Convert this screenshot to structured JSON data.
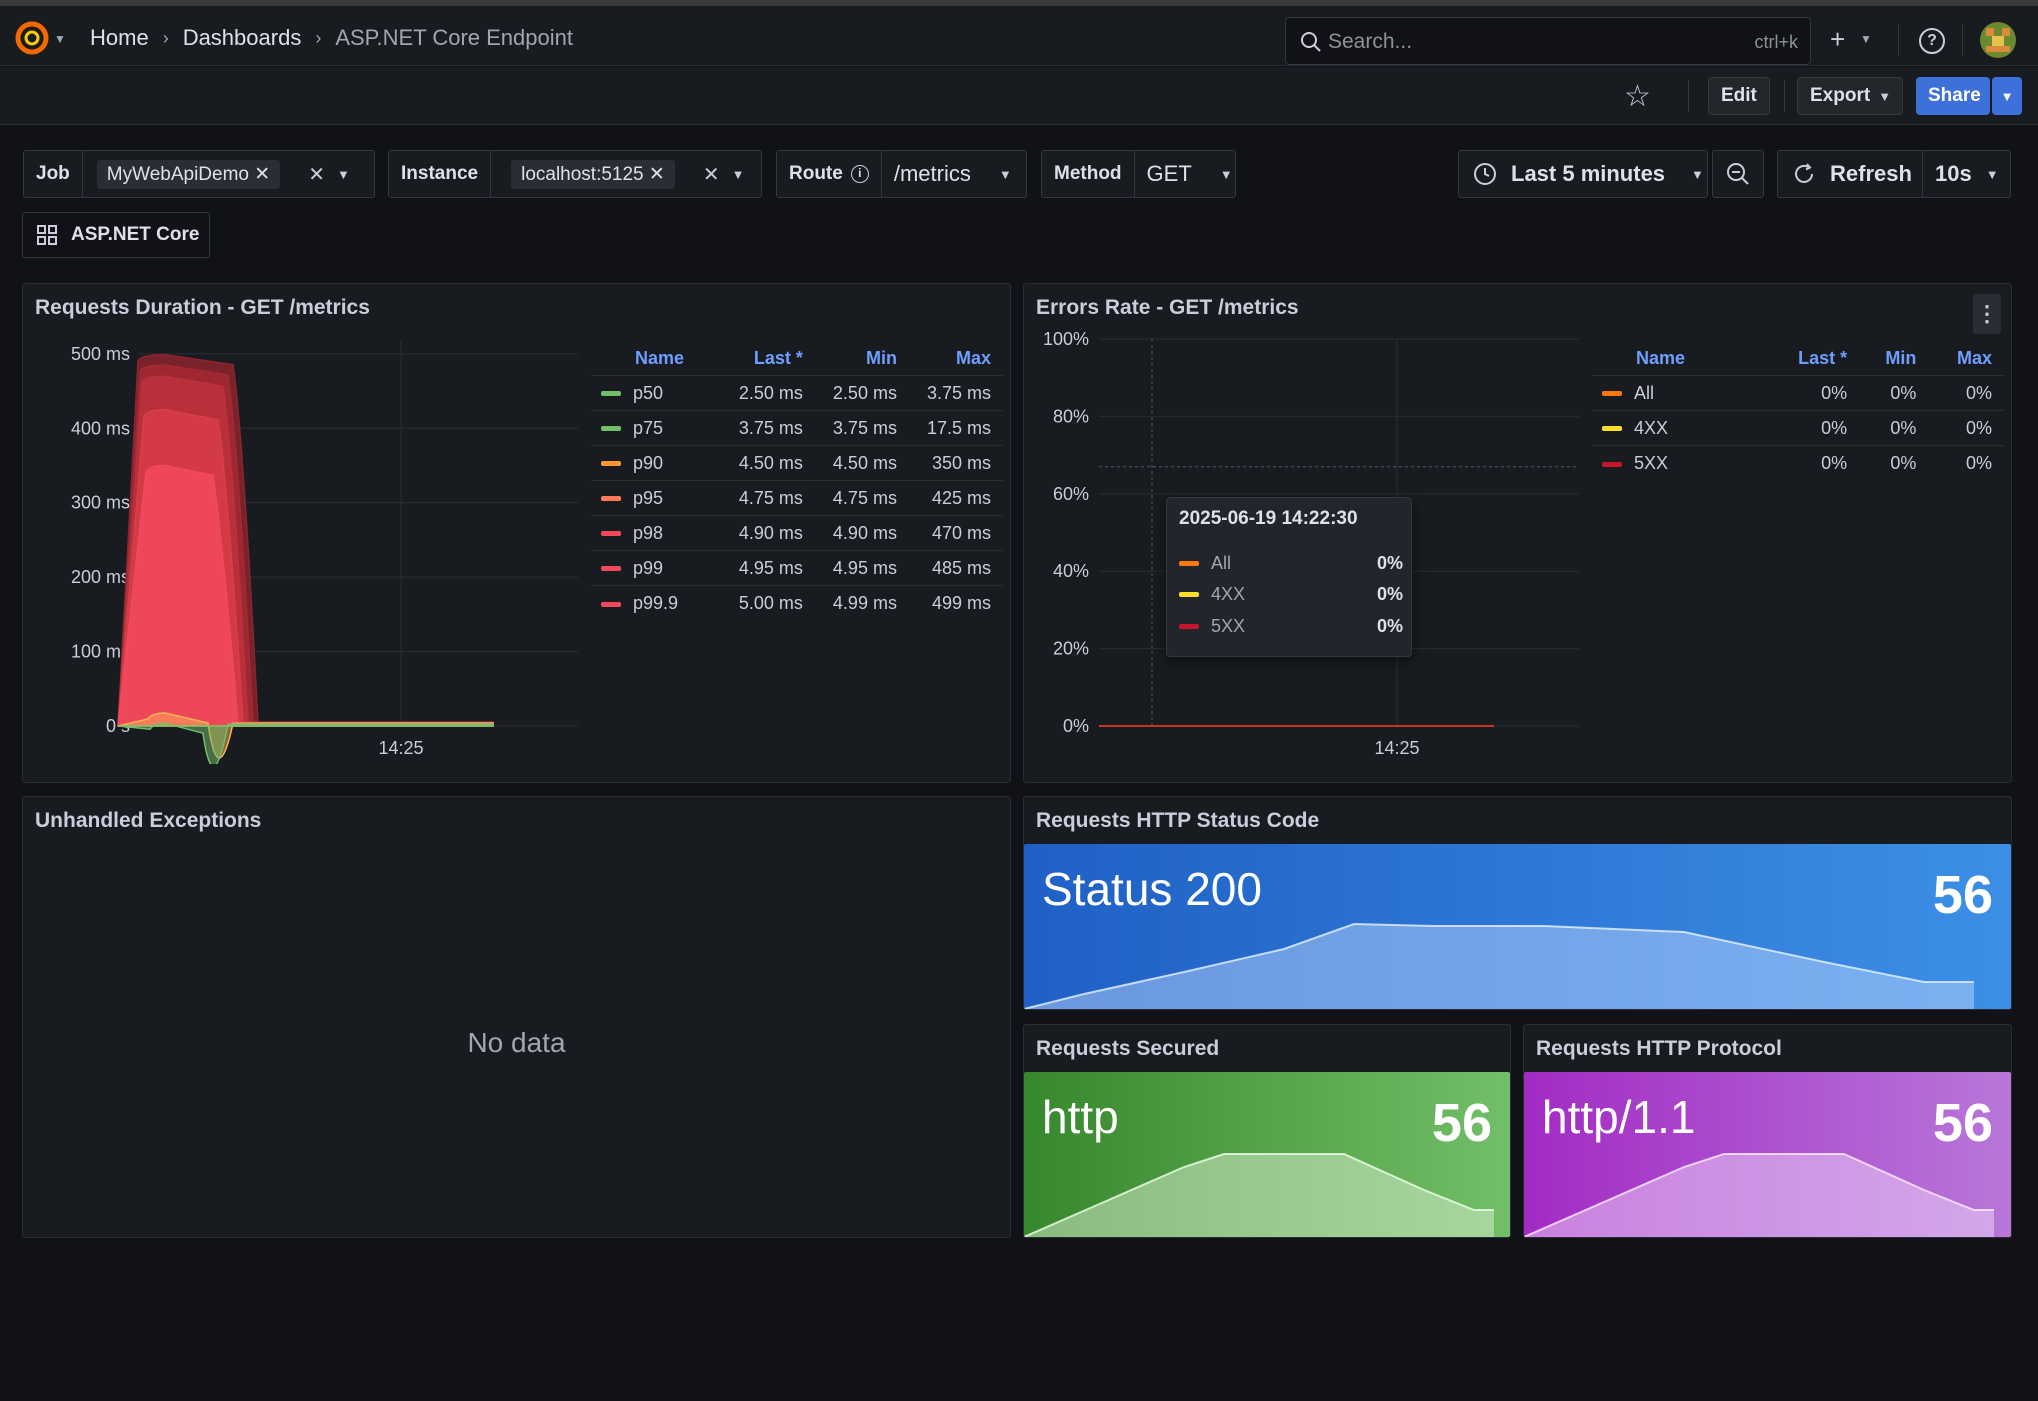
{
  "breadcrumb": {
    "home": "Home",
    "dashboards": "Dashboards",
    "current": "ASP.NET Core Endpoint"
  },
  "search": {
    "placeholder": "Search...",
    "shortcut": "ctrl+k"
  },
  "toolbar": {
    "edit": "Edit",
    "export": "Export",
    "share": "Share"
  },
  "variables": {
    "job": {
      "label": "Job",
      "value": "MyWebApiDemo"
    },
    "instance": {
      "label": "Instance",
      "value": "localhost:5125"
    },
    "route": {
      "label": "Route",
      "value": "/metrics"
    },
    "method": {
      "label": "Method",
      "value": "GET"
    }
  },
  "time": {
    "range": "Last 5 minutes",
    "refresh": "Refresh",
    "interval": "10s"
  },
  "link_button": "ASP.NET Core",
  "panels": {
    "duration": {
      "title": "Requests Duration - GET /metrics",
      "legend_headers": [
        "Name",
        "Last *",
        "Min",
        "Max"
      ],
      "legend": [
        {
          "name": "p50",
          "last": "2.50 ms",
          "min": "2.50 ms",
          "max": "3.75 ms",
          "color": "#73bf69"
        },
        {
          "name": "p75",
          "last": "3.75 ms",
          "min": "3.75 ms",
          "max": "17.5 ms",
          "color": "#73bf69"
        },
        {
          "name": "p90",
          "last": "4.50 ms",
          "min": "4.50 ms",
          "max": "350 ms",
          "color": "#ff9830"
        },
        {
          "name": "p95",
          "last": "4.75 ms",
          "min": "4.75 ms",
          "max": "425 ms",
          "color": "#ff7b57"
        },
        {
          "name": "p98",
          "last": "4.90 ms",
          "min": "4.90 ms",
          "max": "470 ms",
          "color": "#f2495c"
        },
        {
          "name": "p99",
          "last": "4.95 ms",
          "min": "4.95 ms",
          "max": "485 ms",
          "color": "#f2495c"
        },
        {
          "name": "p99.9",
          "last": "5.00 ms",
          "min": "4.99 ms",
          "max": "499 ms",
          "color": "#f2495c"
        }
      ]
    },
    "errors": {
      "title": "Errors Rate - GET /metrics",
      "legend_headers": [
        "Name",
        "Last *",
        "Min",
        "Max"
      ],
      "legend": [
        {
          "name": "All",
          "last": "0%",
          "min": "0%",
          "max": "0%",
          "color": "#ff780a"
        },
        {
          "name": "4XX",
          "last": "0%",
          "min": "0%",
          "max": "0%",
          "color": "#fade2a"
        },
        {
          "name": "5XX",
          "last": "0%",
          "min": "0%",
          "max": "0%",
          "color": "#c4162a"
        }
      ],
      "tooltip": {
        "time": "2025-06-19 14:22:30",
        "rows": [
          {
            "name": "All",
            "value": "0%",
            "color": "#ff780a"
          },
          {
            "name": "4XX",
            "value": "0%",
            "color": "#fade2a"
          },
          {
            "name": "5XX",
            "value": "0%",
            "color": "#c4162a"
          }
        ]
      }
    },
    "exceptions": {
      "title": "Unhandled Exceptions",
      "empty": "No data"
    },
    "status_code": {
      "title": "Requests HTTP Status Code",
      "label": "Status 200",
      "value": "56"
    },
    "secured": {
      "title": "Requests Secured",
      "label": "http",
      "value": "56"
    },
    "protocol": {
      "title": "Requests HTTP Protocol",
      "label": "http/1.1",
      "value": "56"
    }
  },
  "chart_data": [
    {
      "type": "area",
      "title": "Requests Duration - GET /metrics",
      "y_ticks": [
        "0 s",
        "100 ms",
        "200 ms",
        "300 ms",
        "400 ms",
        "500 ms"
      ],
      "x_ticks": [
        "14:25"
      ],
      "ylim": [
        0,
        520
      ],
      "series": [
        {
          "name": "p99.9",
          "peak": 499,
          "last": 5.0
        },
        {
          "name": "p99",
          "peak": 485,
          "last": 4.95
        },
        {
          "name": "p98",
          "peak": 470,
          "last": 4.9
        },
        {
          "name": "p95",
          "peak": 425,
          "last": 4.75
        },
        {
          "name": "p90",
          "peak": 350,
          "last": 4.5
        },
        {
          "name": "p75",
          "peak": 17.5,
          "last": 3.75
        },
        {
          "name": "p50",
          "peak": 3.75,
          "last": 2.5
        }
      ]
    },
    {
      "type": "line",
      "title": "Errors Rate - GET /metrics",
      "y_ticks": [
        "0%",
        "20%",
        "40%",
        "60%",
        "80%",
        "100%"
      ],
      "x_ticks": [
        "14:25"
      ],
      "ylim": [
        0,
        100
      ],
      "series": [
        {
          "name": "All",
          "value": 0
        },
        {
          "name": "4XX",
          "value": 0
        },
        {
          "name": "5XX",
          "value": 0
        }
      ]
    }
  ]
}
